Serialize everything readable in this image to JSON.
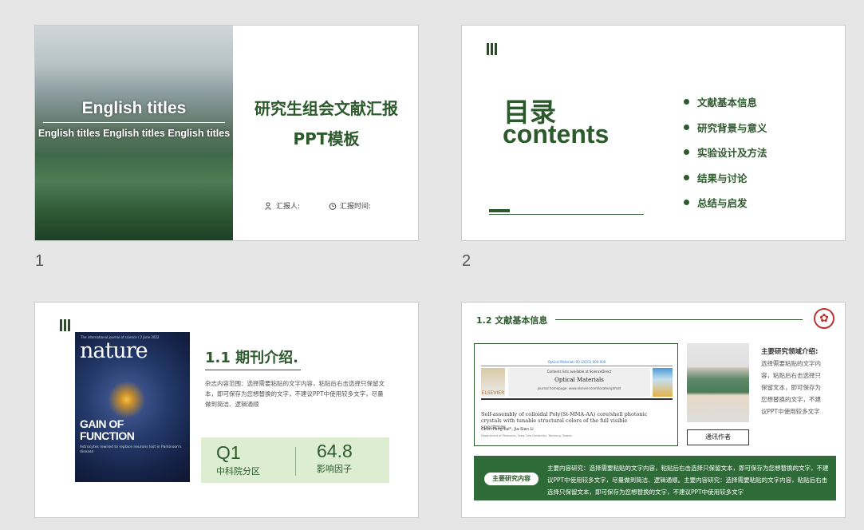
{
  "slides": [
    {
      "number": "1",
      "english_title": "English titles",
      "english_subtitle": "English titles  English titles English titles",
      "title_line1": "研究生组会文献汇报",
      "title_line2": "PPT模板",
      "reporter_label": "汇报人:",
      "time_label": "汇报时间:"
    },
    {
      "number": "2",
      "mulu": "目录",
      "contents": "contents",
      "toc": [
        "文献基本信息",
        "研究背景与意义",
        "实验设计及方法",
        "结果与讨论",
        "总结与启发"
      ]
    },
    {
      "number": "",
      "cover_tag": "The international journal of science / 2 June 2022",
      "cover_title": "nature",
      "cover_headline1": "GAIN OF",
      "cover_headline2": "FUNCTION",
      "cover_sub": "Astrocytes rewired to replace neurons lost in Parkinson's disease",
      "heading": "1.1 期刊介绍.",
      "description": "杂志内容范围：选择需要粘贴的文字内容，粘贴后右击选择只保留文本，即可保存为您想替换的文字，不建议PPT中使用较多文字，尽量做到简洁、逻辑通顺",
      "quartile": "Q1",
      "quartile_label": "中科院分区",
      "impact": "64.8",
      "impact_label": "影响因子"
    },
    {
      "number": "",
      "heading": "1.2 文献基本信息",
      "paper_top": "Optical Materials 00 (2015) 000-000",
      "paper_journal_line": "Contents lists available at ScienceDirect",
      "paper_journal": "Optical Materials",
      "paper_home": "journal homepage: www.elsevier.com/locate/optmat",
      "paper_publisher": "ELSEVIER",
      "paper_title": "Self-assembly of colloidal Poly(St-MMA-AA) core/shell photonic crystals with tunable structural colors of the full visible spectrum",
      "paper_authors": "Chun-Feng Lai*, Jia-Sian Li",
      "paper_affiliation": "Department of Photonics, Feng Chia University, Taichung, Taiwan",
      "author_button": "通讯作者",
      "research_title": "主要研究领域介绍:",
      "research_text": "选择需要粘贴的文字内容，粘贴后右击选择只保留文本，即可保存为您想替换的文字，不建议PPT中使用较多文字",
      "pill": "主要研究内容",
      "band_text": "主要内容研究：选择需要粘贴的文字内容，粘贴后右击选择只保留文本，即可保存为您想替换的文字，不建议PPT中使用较多文字，尽量做到简洁、逻辑通顺。主要内容研究：选择需要粘贴的文字内容，粘贴后右击选择只保留文本，即可保存为您想替换的文字，不建议PPT中使用较多文字",
      "logo_icon": "university-seal-icon"
    }
  ],
  "colors": {
    "accent": "#2d5a2d",
    "band": "#2f6b38",
    "light_box": "#dcedd2",
    "background": "#e6e6e6"
  }
}
